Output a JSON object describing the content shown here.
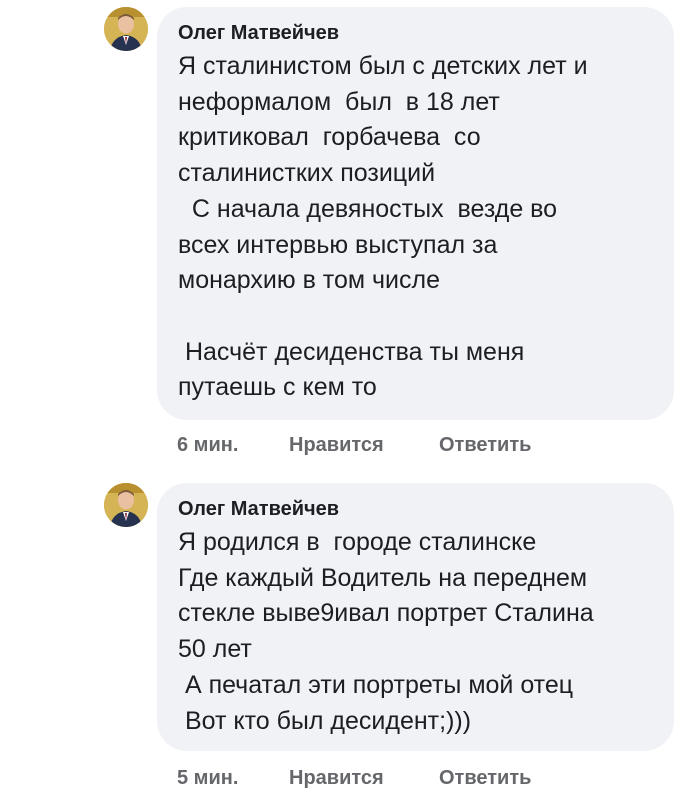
{
  "comments": [
    {
      "author": "Олег Матвейчев",
      "lines": [
        "Я сталинистом был с детских лет и",
        "неформалом  был  в 18 лет",
        "критиковал  горбачева  со",
        "сталинистких позиций",
        "  С начала девяностых  везде во",
        "всех интервью выступал за",
        "монархию в том числе",
        "",
        " Насчёт десиденства ты меня",
        "путаешь с кем то"
      ],
      "time": "6 мин.",
      "like_label": "Нравится",
      "reply_label": "Ответить"
    },
    {
      "author": "Олег Матвейчев",
      "lines": [
        "Я родился в  городе сталинске",
        "Где каждый Водитель на переднем",
        "стекле выве9ивал портрет Сталина",
        "50 лет",
        " А печатал эти портреты мой отец",
        " Вот кто был десидент;)))"
      ],
      "time": "5 мин.",
      "like_label": "Нравится",
      "reply_label": "Ответить"
    }
  ],
  "colors": {
    "bubble": "#f0f2f5",
    "text": "#1c1e21",
    "meta": "#65676b",
    "avatar_bg": "#c9a74a"
  }
}
